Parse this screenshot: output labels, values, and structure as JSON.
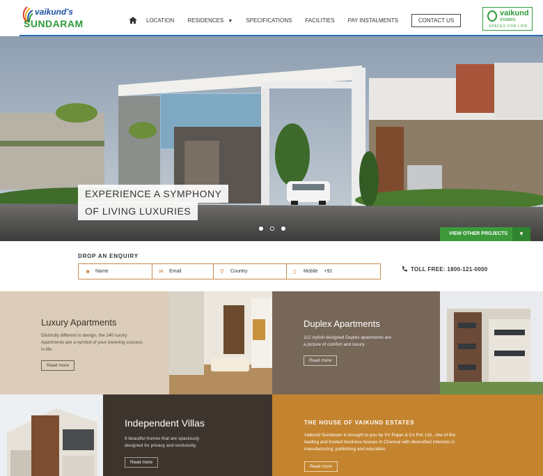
{
  "header": {
    "logo": {
      "line1": "vaikund's",
      "line2": "SUNDARAM"
    },
    "nav": [
      {
        "label": "LOCATION"
      },
      {
        "label": "RESIDENCES",
        "caret": "▼"
      },
      {
        "label": "SPECIFICATIONS"
      },
      {
        "label": "FACILITIES"
      },
      {
        "label": "PAY INSTALMENTS"
      },
      {
        "label": "CONTACT US"
      }
    ],
    "partner_logo": {
      "name": "vaikund",
      "sub": "estates",
      "tagline": "SPACES FOR LIFE"
    }
  },
  "hero": {
    "tagline1": "EXPERIENCE A SYMPHONY",
    "tagline2": "OF LIVING LUXURIES",
    "slides": 3,
    "active_slide": 2,
    "cta": "VIEW OTHER PROJECTS",
    "cta_arrow": "▼"
  },
  "enquiry": {
    "title": "DROP AN ENQUIRY",
    "fields": [
      {
        "icon": "user-icon",
        "label": "Name"
      },
      {
        "icon": "mail-icon",
        "label": "Email"
      },
      {
        "icon": "location-icon",
        "label": "Country"
      },
      {
        "icon": "mobile-icon",
        "label": "Mobile",
        "prefix": "+91"
      }
    ],
    "toll_free": "TOLL FREE: 1800-121-0000"
  },
  "tiles": {
    "luxury": {
      "title": "Luxury Apartments",
      "text": "Distinctly different in design, the 240 luxury Apartments are a symbol of your towering success in life.",
      "button": "Read more"
    },
    "duplex": {
      "title": "Duplex Apartments",
      "text": "112 stylish designed Duplex apartments are a picture of comfort and luxury.",
      "button": "Read more"
    },
    "villas": {
      "title": "Independent Villas",
      "text": "9 beautiful homes that are spaciously designed for privacy and exclusivity.",
      "button": "Read more"
    },
    "house": {
      "title": "THE HOUSE OF VAIKUND ESTATES",
      "text": "Vaikund Sundaram is brought to you by VV Rajan & Co Pvt. Ltd., one of the leading and trusted business houses in Chennai with diversified interests in manufacturing, publishing and education",
      "button": "Read more"
    }
  },
  "colors": {
    "nav_line": "#2a6db5",
    "accent_green": "#3c9a3a",
    "form_border": "#c8894a",
    "tile_beige": "#dbcdb9",
    "tile_brown": "#776759",
    "tile_dark": "#3e342e",
    "tile_orange": "#c4842f"
  }
}
